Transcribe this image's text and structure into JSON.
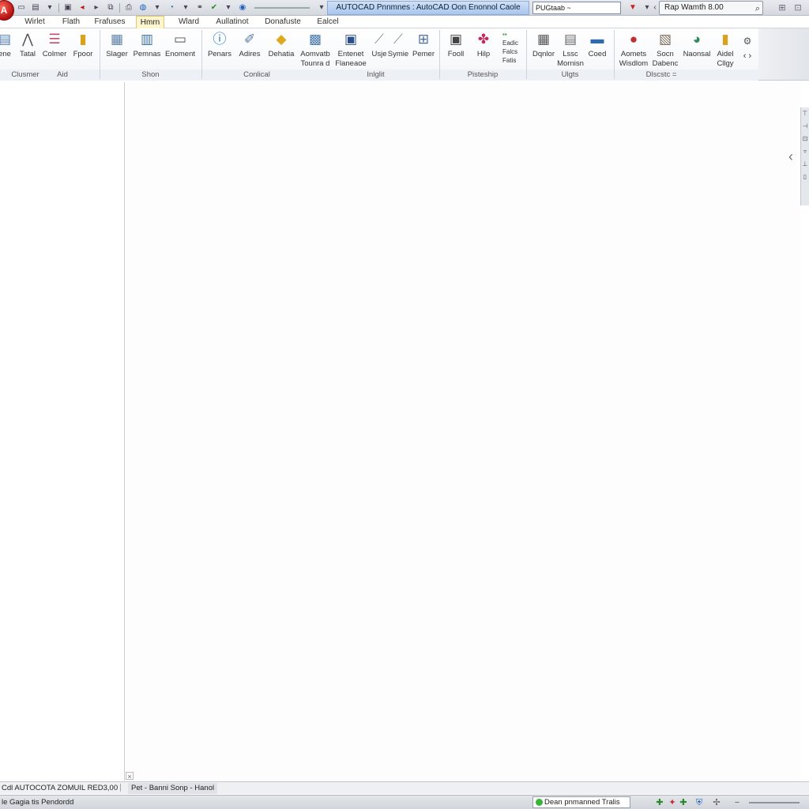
{
  "window": {
    "title": "AUTOCAD Pnnmnes : AutoCAD Oon Enonnol Caole",
    "title_input": "PUGtaab ~",
    "search_box": "Rap Wamth 8.00",
    "app_button": "A"
  },
  "tabs": [
    "Wirlet",
    "Flath",
    "Frafuses",
    "Hmrn",
    "Wlard",
    "Aullatinot",
    "Donafuste",
    "Ealcel"
  ],
  "active_tab": "Hmrn",
  "ribbon": {
    "buttons": [
      {
        "label": "ene",
        "icon": "ruler-icon"
      },
      {
        "label": "Tatal",
        "icon": "compass-icon"
      },
      {
        "label": "Colmer",
        "icon": "form-icon"
      },
      {
        "label": "Fpoor",
        "icon": "folder-icon"
      },
      {
        "label": "Slager",
        "icon": "drawing-icon"
      },
      {
        "label": "Pemnas",
        "icon": "table-icon"
      },
      {
        "label": "Enoment",
        "icon": "monitor-icon"
      },
      {
        "label": "Penars",
        "icon": "info-icon"
      },
      {
        "label": "Adires",
        "icon": "pencil-icon"
      },
      {
        "label": "Dehatia",
        "icon": "tag-icon"
      },
      {
        "label": "Aomvatb",
        "label2": "Tounra d",
        "icon": "image-icon"
      },
      {
        "label": "Entenet",
        "label2": "Flaneaoe",
        "icon": "save-icon"
      },
      {
        "label": "Usje",
        "icon": "paper-icon"
      },
      {
        "label": "Symie",
        "icon": "symbol-icon"
      },
      {
        "label": "Pemer",
        "icon": "printer-icon"
      },
      {
        "label": "Fooll",
        "icon": "screen-icon"
      },
      {
        "label": "Hilp",
        "icon": "pinwheel-icon"
      },
      {
        "label": "Dqnlor",
        "icon": "calculator-icon"
      },
      {
        "label": "Lssc",
        "label2": "Mornisn",
        "icon": "grid-icon"
      },
      {
        "label": "Coed",
        "icon": "panel-icon"
      },
      {
        "label": "Aomets",
        "label2": "Wisdlom",
        "icon": "globe-icon"
      },
      {
        "label": "Socn",
        "label2": "Dabenc",
        "icon": "chart-icon"
      },
      {
        "label": "Naonsal",
        "icon": "cup-icon"
      },
      {
        "label": "Aidel",
        "label2": "Cllgy",
        "icon": "note-icon"
      }
    ],
    "small_buttons": [
      "Eadic",
      "Falcs",
      "Fatis"
    ],
    "groups": [
      "Clusmer",
      "Aid",
      "Shon",
      "Conlical",
      "Inlglit",
      "Pisteship",
      "Ulgts",
      "Dlscstc ="
    ]
  },
  "command_line": {
    "left": "Cdl AUTOCOTA ZOMUIL RED3,00",
    "right": "Pet - Banni Sonp - Hanol"
  },
  "status_bar": {
    "text": "le Gagia tis Pendordd",
    "field": "Dean pnmanned Tralis"
  }
}
